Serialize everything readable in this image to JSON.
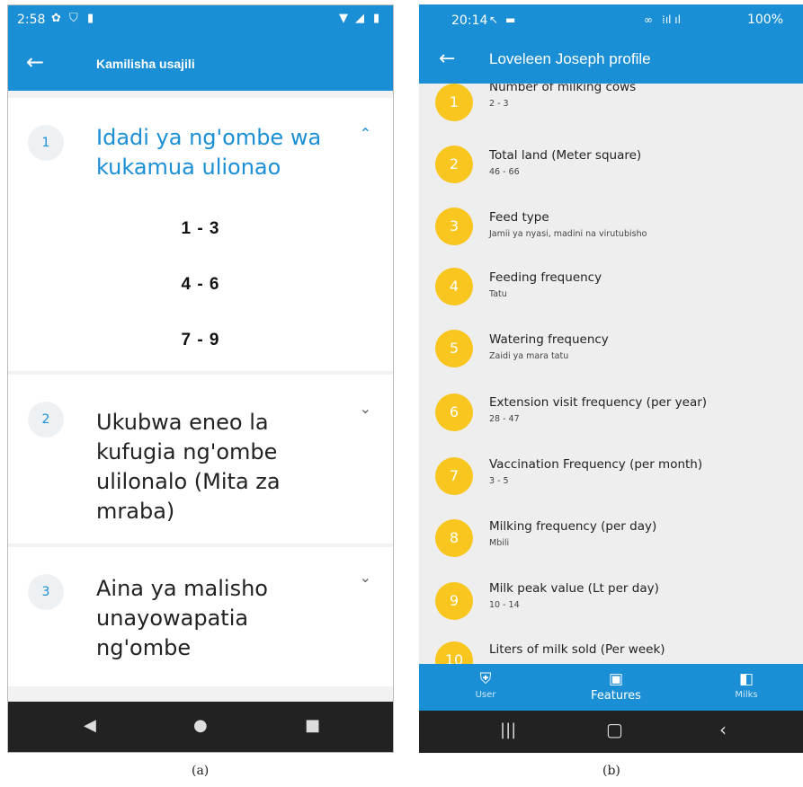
{
  "phone_a": {
    "status_bar": {
      "time": "2:58"
    },
    "app_bar": {
      "title": "Kamilisha usajili"
    },
    "questions": [
      {
        "number": "1",
        "text": "Idadi ya ng'ombe wa kukamua ulionao",
        "expanded": true,
        "options": [
          "1 - 3",
          "4 - 6",
          "7 - 9"
        ]
      },
      {
        "number": "2",
        "text": "Ukubwa eneo la kufugia ng'ombe ulilonalo (Mita za mraba)",
        "expanded": false
      },
      {
        "number": "3",
        "text": "Aina ya malisho unayowapatia ng'ombe",
        "expanded": false
      }
    ]
  },
  "phone_b": {
    "status_bar": {
      "time": "20:14",
      "battery": "100%"
    },
    "app_bar": {
      "title": "Loveleen Joseph profile"
    },
    "features": [
      {
        "number": "1",
        "title": "Number of milking cows",
        "value": "2 - 3"
      },
      {
        "number": "2",
        "title": "Total land (Meter square)",
        "value": "46 - 66"
      },
      {
        "number": "3",
        "title": "Feed type",
        "value": "Jamii ya nyasi, madini na virutubisho"
      },
      {
        "number": "4",
        "title": "Feeding frequency",
        "value": "Tatu"
      },
      {
        "number": "5",
        "title": "Watering frequency",
        "value": "Zaidi ya  mara tatu"
      },
      {
        "number": "6",
        "title": "Extension visit frequency (per year)",
        "value": "28 - 47"
      },
      {
        "number": "7",
        "title": "Vaccination Frequency (per month)",
        "value": "3 - 5"
      },
      {
        "number": "8",
        "title": "Milking frequency (per day)",
        "value": "Mbili"
      },
      {
        "number": "9",
        "title": "Milk peak value (Lt per day)",
        "value": "10 - 14"
      },
      {
        "number": "10",
        "title": "Liters of milk sold (Per week)",
        "value": ""
      }
    ],
    "bottom_nav": [
      {
        "label": "User",
        "icon": "shield-check-icon",
        "active": false
      },
      {
        "label": "Features",
        "icon": "id-card-icon",
        "active": true
      },
      {
        "label": "Milks",
        "icon": "compare-icon",
        "active": false
      }
    ]
  },
  "captions": {
    "a": "(a)",
    "b": "(b)"
  },
  "colors": {
    "primary": "#1a8fd6",
    "badge": "#f8c61e",
    "navbar": "#222222"
  }
}
